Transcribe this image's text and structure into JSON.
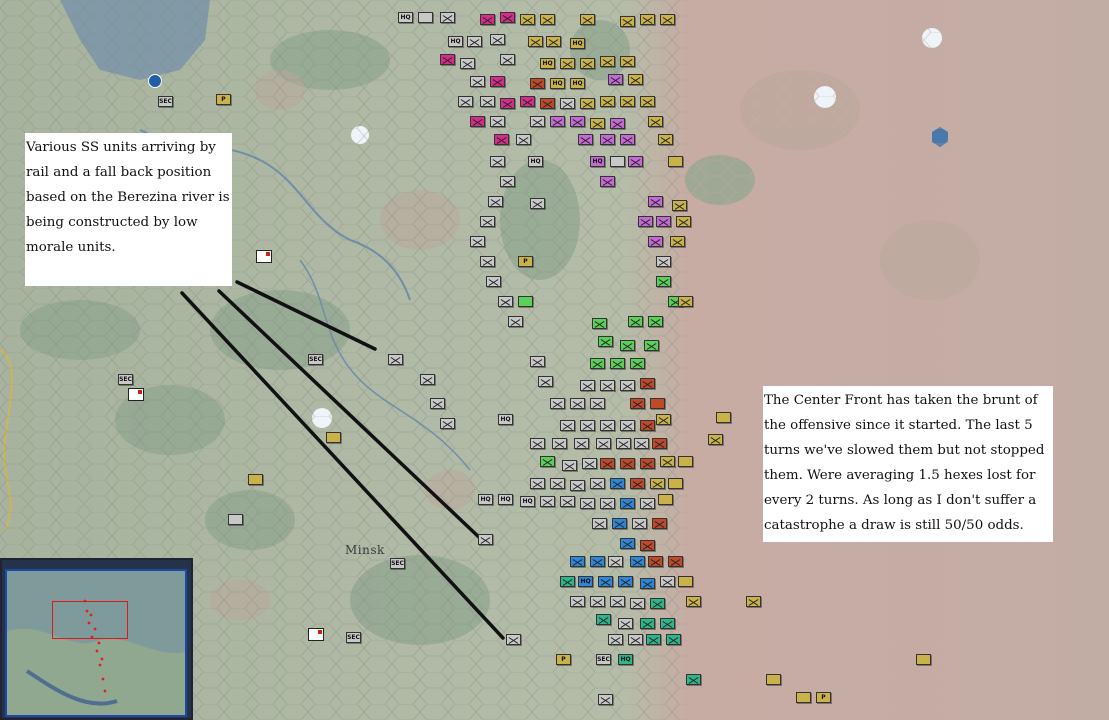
{
  "map": {
    "places": [
      {
        "name": "Minsk"
      }
    ],
    "unit_label_hq": "HQ",
    "unit_label_sec": "SEC",
    "unit_label_p": "P"
  },
  "annotations": {
    "left_note": "Various SS units arriving by rail and a fall back position based on the Berezina river is being constructed by low morale units.",
    "right_note": "The Center Front has taken the brunt of the offensive since it started. The last 5 turns we've slowed them but not stopped them. Were averaging 1.5 hexes lost for every 2 turns. As long as I don't suffer a catastrophe a draw is still 50/50 odds."
  },
  "colors": {
    "axis_gray": "#c8c8c8",
    "soviet_gold": "#c9b24a",
    "soviet_red": "#c0492a",
    "magenta": "#d52d8a",
    "lilac": "#c36ad3",
    "green": "#5bcf5a",
    "teal": "#2fb58a",
    "blue": "#2f86d6",
    "white": "#ffffff",
    "minimap_border": "#1c49a8",
    "minimap_view": "#e01818"
  },
  "icons": [
    "city-anchor-icon",
    "fortified-hq-icon",
    "hex-grid-icon"
  ]
}
